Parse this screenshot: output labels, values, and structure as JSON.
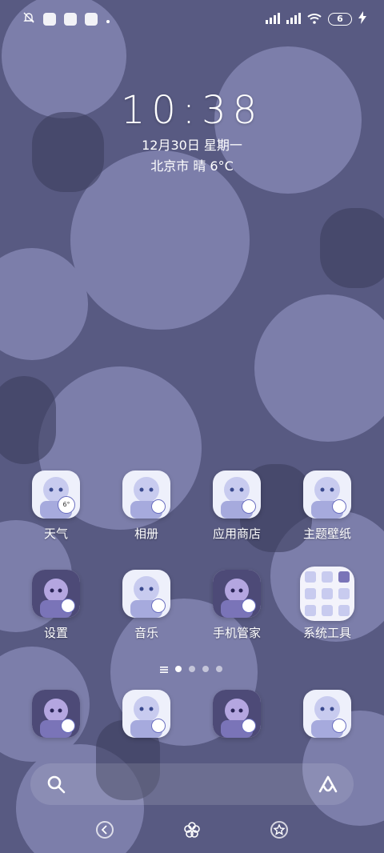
{
  "status_bar": {
    "battery_level": "6",
    "icons": [
      "mute-icon",
      "app-notification-icon",
      "app-notification-icon",
      "app-notification-icon",
      "dot-icon",
      "signal-icon",
      "signal-icon",
      "wifi-icon",
      "battery-icon",
      "charging-icon"
    ]
  },
  "lockclock": {
    "time": "10:38",
    "date": "12月30日 星期一",
    "weather": "北京市 晴 6°C"
  },
  "apps": [
    {
      "label": "天气",
      "badge": "6°"
    },
    {
      "label": "相册",
      "badge": ""
    },
    {
      "label": "应用商店",
      "badge": ""
    },
    {
      "label": "主题壁纸",
      "badge": ""
    },
    {
      "label": "设置",
      "badge": ""
    },
    {
      "label": "音乐",
      "badge": ""
    },
    {
      "label": "手机管家",
      "badge": ""
    },
    {
      "label": "系统工具",
      "badge": ""
    }
  ],
  "pager": {
    "pages": 4,
    "active": 0
  },
  "dock": [
    {
      "icon": "phone-icon"
    },
    {
      "icon": "browser-icon"
    },
    {
      "icon": "messages-icon"
    },
    {
      "icon": "camera-icon"
    }
  ],
  "search_bar": {
    "left_icon": "search-icon",
    "right_icon": "assistant-icon"
  },
  "colors": {
    "wallpaper": "#585a82",
    "icon_bg": "#eef0fb",
    "accent": "#6a6ec0"
  }
}
